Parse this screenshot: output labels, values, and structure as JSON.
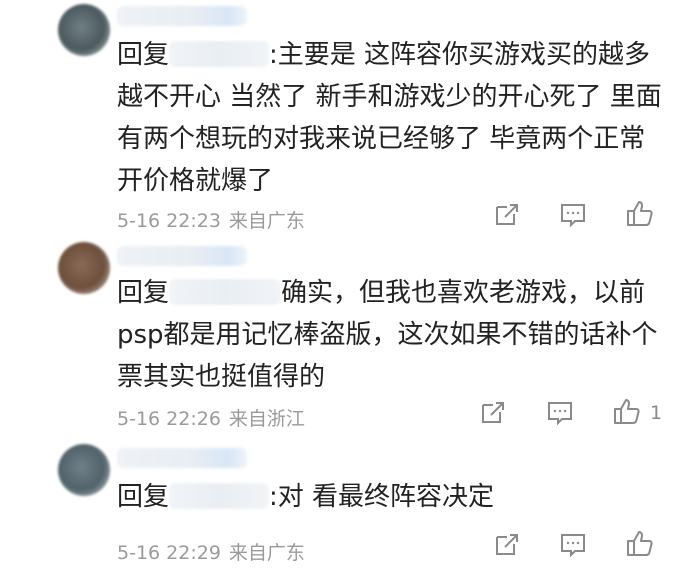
{
  "comments": [
    {
      "reply_prefix": "回复",
      "body": ":主要是 这阵容你买游戏买的越多越不开心 当然了 新手和游戏少的开心死了 里面有两个想玩的对我来说已经够了 毕竟两个正常开价格就爆了",
      "date": "5-16 22:23",
      "location": "来自广东",
      "likes": ""
    },
    {
      "reply_prefix": "回复",
      "body": "确实，但我也喜欢老游戏，以前psp都是用记忆棒盗版，这次如果不错的话补个票其实也挺值得的",
      "date": "5-16 22:26",
      "location": "来自浙江",
      "likes": "1"
    },
    {
      "reply_prefix": "回复",
      "body": ":对 看最终阵容决定",
      "date": "5-16 22:29",
      "location": "来自广东",
      "likes": ""
    }
  ],
  "icons": {
    "share": "share-icon",
    "comment": "comment-icon",
    "like": "thumbs-up-icon"
  }
}
